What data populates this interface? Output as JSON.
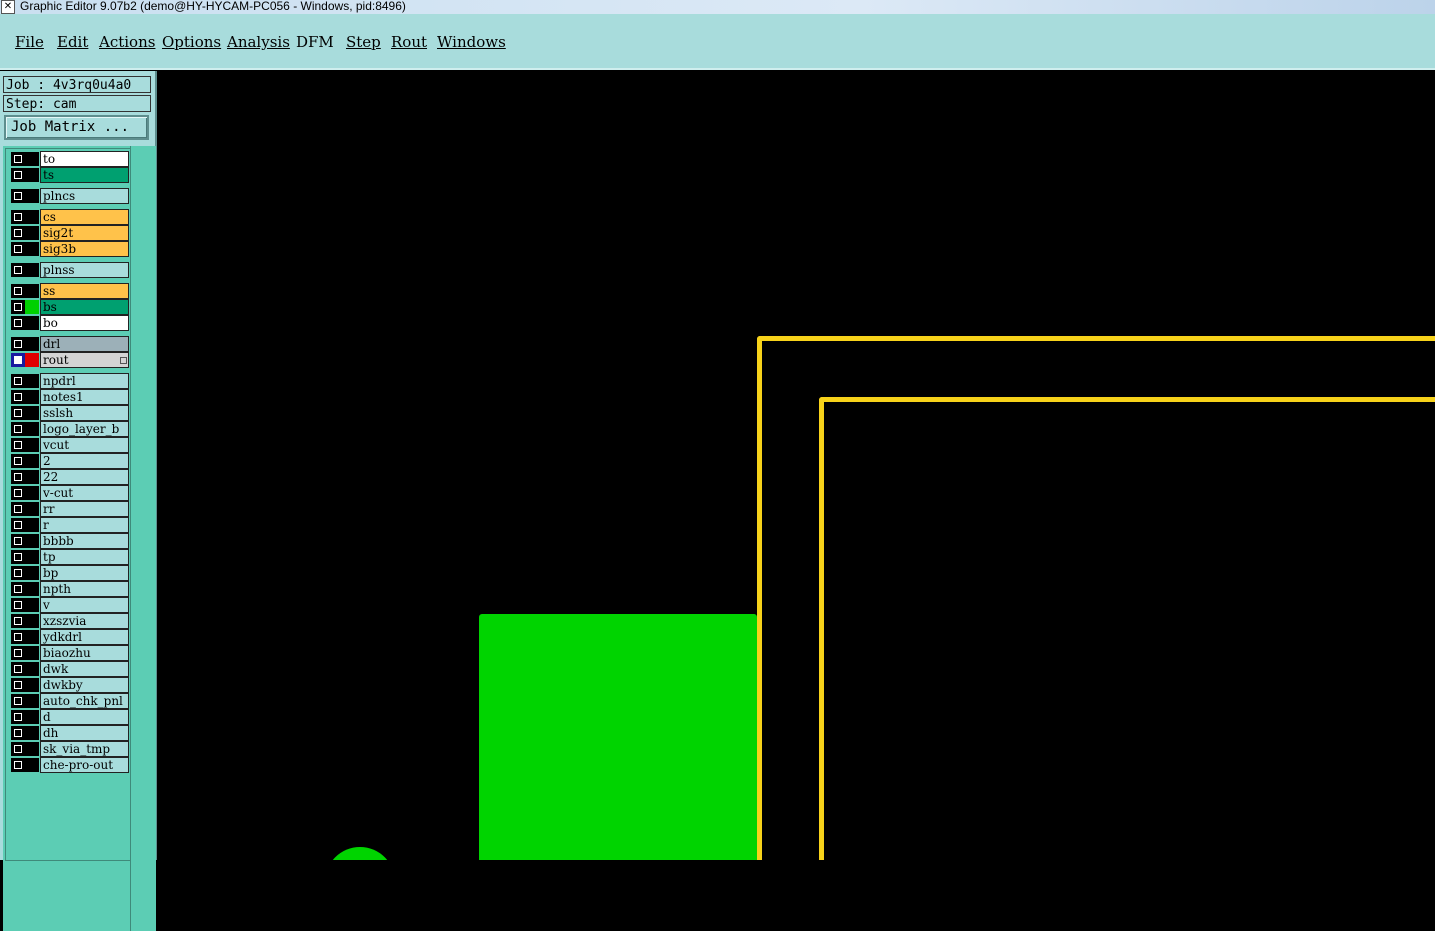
{
  "window": {
    "title": "Graphic Editor 9.07b2 (demo@HY-HYCAM-PC056 - Windows, pid:8496)"
  },
  "menu": [
    {
      "label": "File"
    },
    {
      "label": "Edit"
    },
    {
      "label": "Actions"
    },
    {
      "label": "Options"
    },
    {
      "label": "Analysis"
    },
    {
      "label": "DFM"
    },
    {
      "label": "Step"
    },
    {
      "label": "Rout"
    },
    {
      "label": "Windows"
    }
  ],
  "job": {
    "job_label": "Job : 4v3rq0u4a0",
    "step_label": "Step: cam",
    "matrix_button": "Job Matrix ..."
  },
  "layers": [
    {
      "name": "to",
      "color": "white"
    },
    {
      "name": "ts",
      "color": "green"
    },
    {
      "name": "plncs",
      "color": "teal"
    },
    {
      "name": "cs",
      "color": "orange"
    },
    {
      "name": "sig2t",
      "color": "orange"
    },
    {
      "name": "sig3b",
      "color": "orange"
    },
    {
      "name": "plnss",
      "color": "teal"
    },
    {
      "name": "ss",
      "color": "orange"
    },
    {
      "name": "bs",
      "color": "green",
      "displayed": true
    },
    {
      "name": "bo",
      "color": "white"
    },
    {
      "name": "drl",
      "color": "gray"
    },
    {
      "name": "rout",
      "color": "lightgray",
      "work": true
    },
    {
      "name": "npdrl",
      "color": "teal"
    },
    {
      "name": "notes1",
      "color": "teal"
    },
    {
      "name": "sslsh",
      "color": "teal"
    },
    {
      "name": "logo_layer_b",
      "color": "teal"
    },
    {
      "name": "vcut",
      "color": "teal"
    },
    {
      "name": "2",
      "color": "teal"
    },
    {
      "name": "22",
      "color": "teal"
    },
    {
      "name": "v-cut",
      "color": "teal"
    },
    {
      "name": "rr",
      "color": "teal"
    },
    {
      "name": "r",
      "color": "teal"
    },
    {
      "name": "bbbb",
      "color": "teal"
    },
    {
      "name": "tp",
      "color": "teal"
    },
    {
      "name": "bp",
      "color": "teal"
    },
    {
      "name": "npth",
      "color": "teal"
    },
    {
      "name": "v",
      "color": "teal"
    },
    {
      "name": "xzszvia",
      "color": "teal"
    },
    {
      "name": "ydkdrl",
      "color": "teal"
    },
    {
      "name": "biaozhu",
      "color": "teal"
    },
    {
      "name": "dwk",
      "color": "teal"
    },
    {
      "name": "dwkby",
      "color": "teal"
    },
    {
      "name": "auto_chk_pnl",
      "color": "teal"
    },
    {
      "name": "d",
      "color": "teal"
    },
    {
      "name": "dh",
      "color": "teal"
    },
    {
      "name": "sk_via_tmp",
      "color": "teal"
    },
    {
      "name": "che-pro-out",
      "color": "teal"
    }
  ],
  "colors": {
    "outline": "#f7d21a",
    "copper": "#00d400",
    "background": "#000000",
    "panel": "#a8dcdc"
  }
}
